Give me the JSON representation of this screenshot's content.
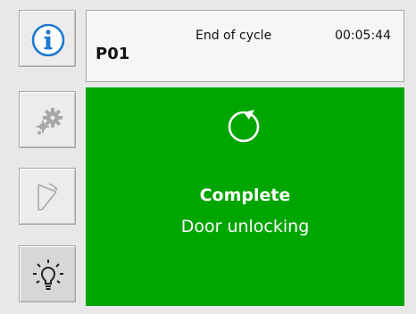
{
  "sidebar": {
    "buttons": [
      {
        "icon": "info-icon",
        "state": "normal"
      },
      {
        "icon": "gear-icon",
        "state": "disabled"
      },
      {
        "icon": "door-icon",
        "state": "disabled"
      },
      {
        "icon": "lightbulb-icon",
        "state": "pressed"
      }
    ]
  },
  "header": {
    "program": "P01",
    "phase": "End of cycle",
    "time": "00:05:44"
  },
  "status": {
    "icon": "cycle-complete-icon",
    "title": "Complete",
    "subtitle": "Door unlocking",
    "color": "#00a600"
  },
  "colors": {
    "info_accent": "#1f78d1",
    "disabled": "#a0a0a0",
    "icon_dark": "#202020"
  }
}
